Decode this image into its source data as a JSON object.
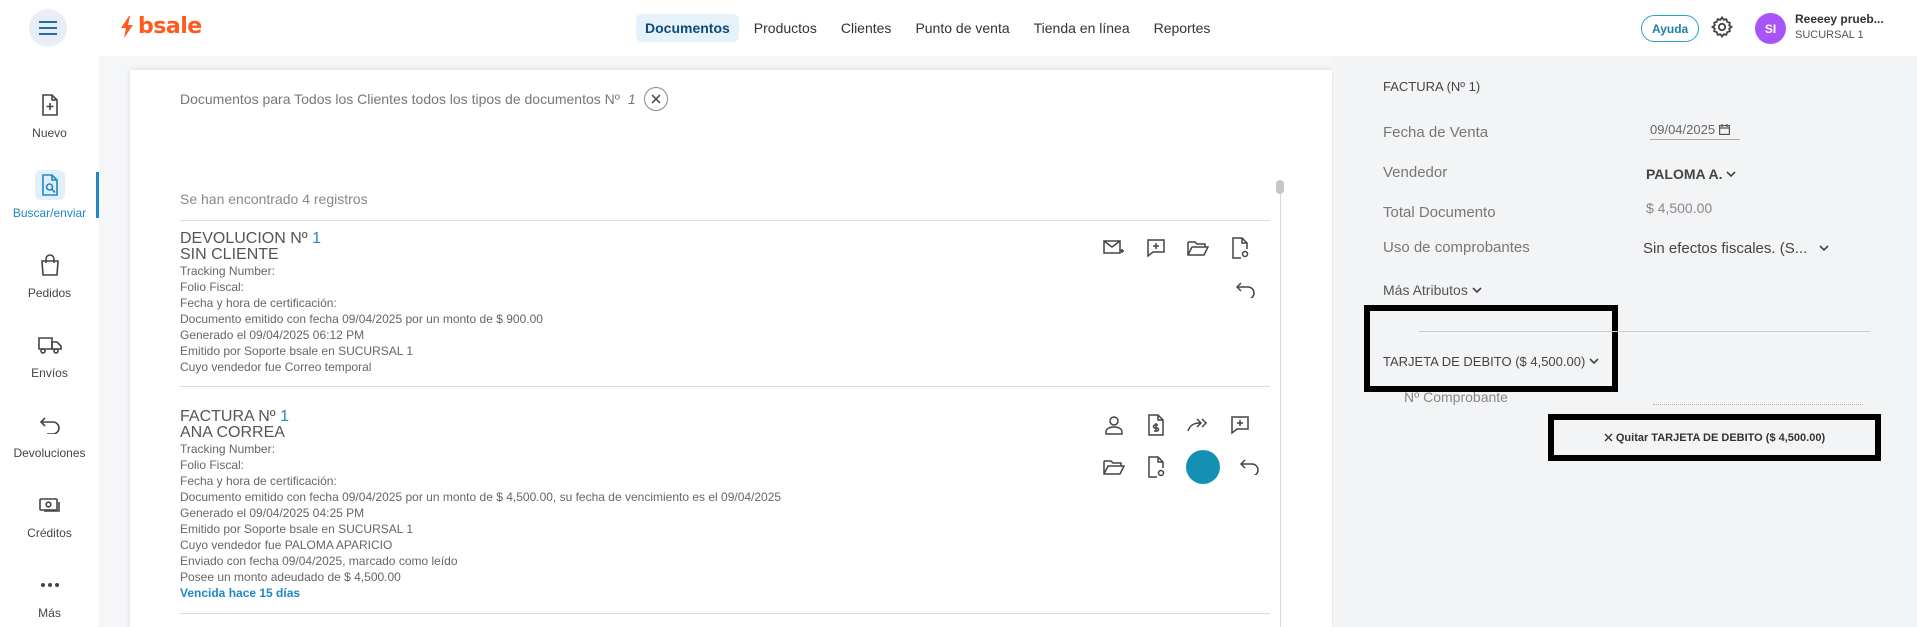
{
  "header": {
    "logo_text": "bsale",
    "nav": [
      "Documentos",
      "Productos",
      "Clientes",
      "Punto de venta",
      "Tienda en línea",
      "Reportes"
    ],
    "help_label": "Ayuda",
    "avatar_initials": "SI",
    "user_name": "Reeeey prueb...",
    "user_branch": "SUCURSAL 1"
  },
  "sidebar": {
    "items": [
      {
        "label": "Nuevo",
        "icon": "new-document-icon"
      },
      {
        "label": "Buscar/enviar",
        "icon": "search-document-icon",
        "active": true
      },
      {
        "label": "Pedidos",
        "icon": "bag-icon"
      },
      {
        "label": "Envíos",
        "icon": "truck-icon"
      },
      {
        "label": "Devoluciones",
        "icon": "return-icon"
      },
      {
        "label": "Créditos",
        "icon": "credit-icon"
      },
      {
        "label": "Más",
        "icon": "more-icon"
      }
    ]
  },
  "main": {
    "search_prefix": "Documentos para Todos los Clientes todos los tipos de documentos Nº",
    "search_num": "1",
    "count": "Se han encontrado 4 registros",
    "records": [
      {
        "title": "DEVOLUCION Nº",
        "num": "1",
        "client": "SIN CLIENTE",
        "lines": [
          "Tracking Number:",
          "Folio Fiscal:",
          "Fecha y hora de certificación:",
          "Documento emitido con fecha 09/04/2025 por un monto de $ 900.00",
          "Generado el 09/04/2025 06:12 PM",
          "Emitido por Soporte bsale en SUCURSAL 1",
          "Cuyo vendedor fue Correo temporal"
        ]
      },
      {
        "title": "FACTURA Nº",
        "num": "1",
        "client": "ANA CORREA",
        "lines": [
          "Tracking Number:",
          "Folio Fiscal:",
          "Fecha y hora de certificación:",
          "Documento emitido con fecha 09/04/2025 por un monto de $ 4,500.00, su fecha de vencimiento es el 09/04/2025",
          "Generado el 09/04/2025 04:25 PM",
          "Emitido por Soporte bsale en SUCURSAL 1",
          "Cuyo vendedor fue PALOMA APARICIO",
          "Enviado con fecha 09/04/2025, marcado como leído",
          "Posee un monto adeudado de $ 4,500.00"
        ],
        "link": "Vencida hace 15 días"
      }
    ]
  },
  "right": {
    "heading": "FACTURA (Nº 1)",
    "fecha_label": "Fecha de Venta",
    "fecha_value": "09/04/2025",
    "vendedor_label": "Vendedor",
    "vendedor_value": "PALOMA A.",
    "total_label": "Total Documento",
    "total_value": "$ 4,500.00",
    "uso_label": "Uso de comprobantes",
    "uso_value": "Sin efectos fiscales. (S...",
    "more_attributes": "Más Atributos",
    "tarjeta": "TARJETA DE DEBITO ($ 4,500.00)",
    "comprobante_label": "Nº Comprobante",
    "quitar": "Quitar TARJETA DE DEBITO ($ 4,500.00)"
  }
}
